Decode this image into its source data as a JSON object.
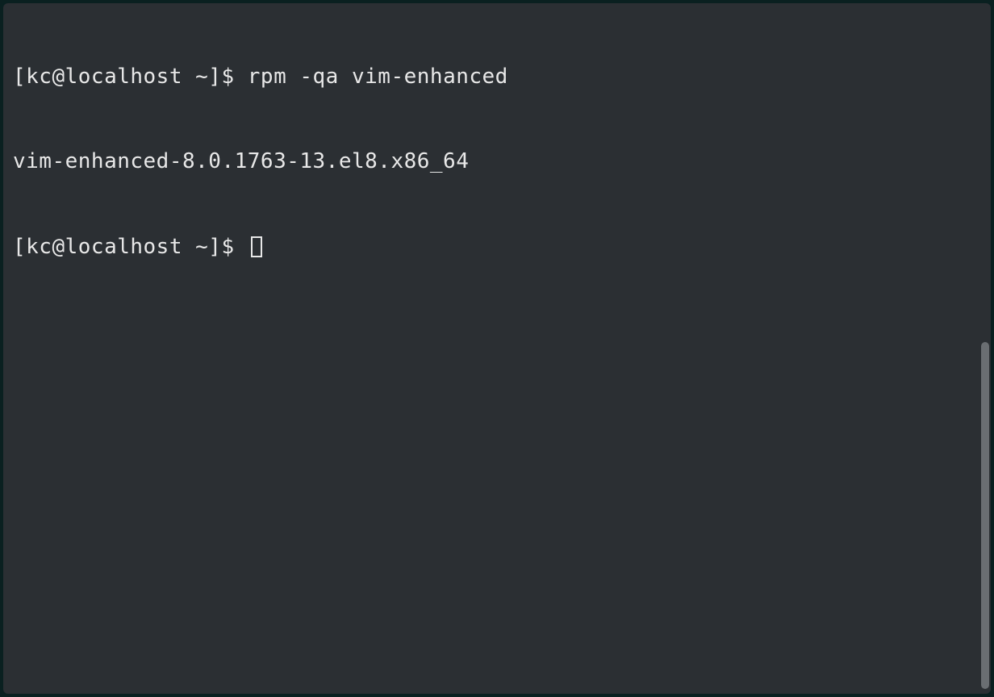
{
  "terminal": {
    "lines": [
      {
        "prompt": "[kc@localhost ~]$ ",
        "command": "rpm -qa vim-enhanced"
      },
      {
        "output": "vim-enhanced-8.0.1763-13.el8.x86_64"
      },
      {
        "prompt": "[kc@localhost ~]$ ",
        "cursor": true
      }
    ]
  }
}
